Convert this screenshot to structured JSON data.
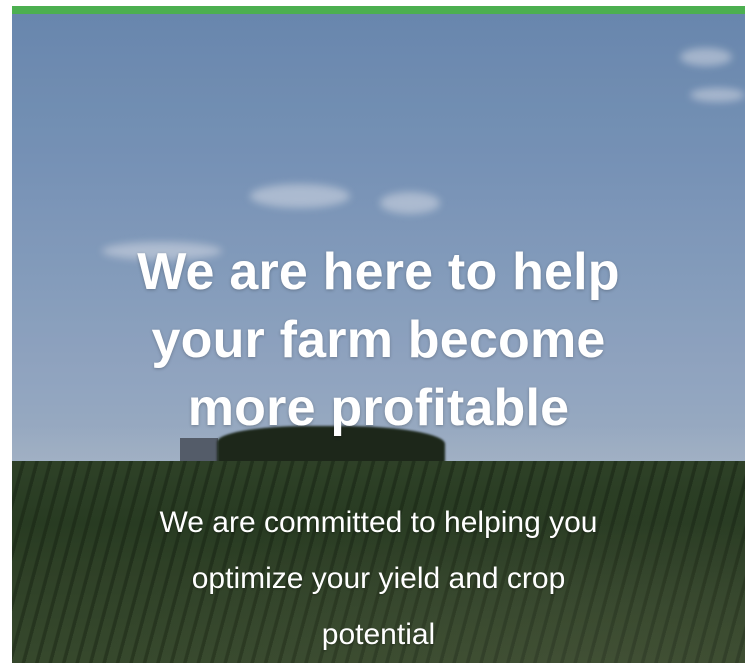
{
  "hero": {
    "accent_color": "#4caf50",
    "headline_lines": [
      "We are here to help",
      "your farm become",
      "more profitable"
    ],
    "subtext_lines": [
      "We are committed to helping you",
      "optimize your yield and crop",
      "potential"
    ]
  }
}
